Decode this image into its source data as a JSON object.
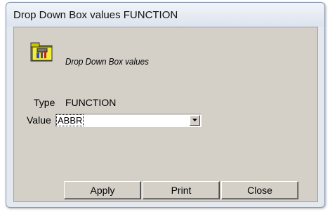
{
  "window": {
    "title": "Drop Down Box values FUNCTION"
  },
  "header": {
    "icon": "tools-folder-icon",
    "text": "Drop Down Box values"
  },
  "form": {
    "type_label": "Type",
    "type_value": "FUNCTION",
    "value_label": "Value",
    "value_selected": "ABBR"
  },
  "buttons": {
    "apply": "Apply",
    "print": "Print",
    "close": "Close"
  }
}
